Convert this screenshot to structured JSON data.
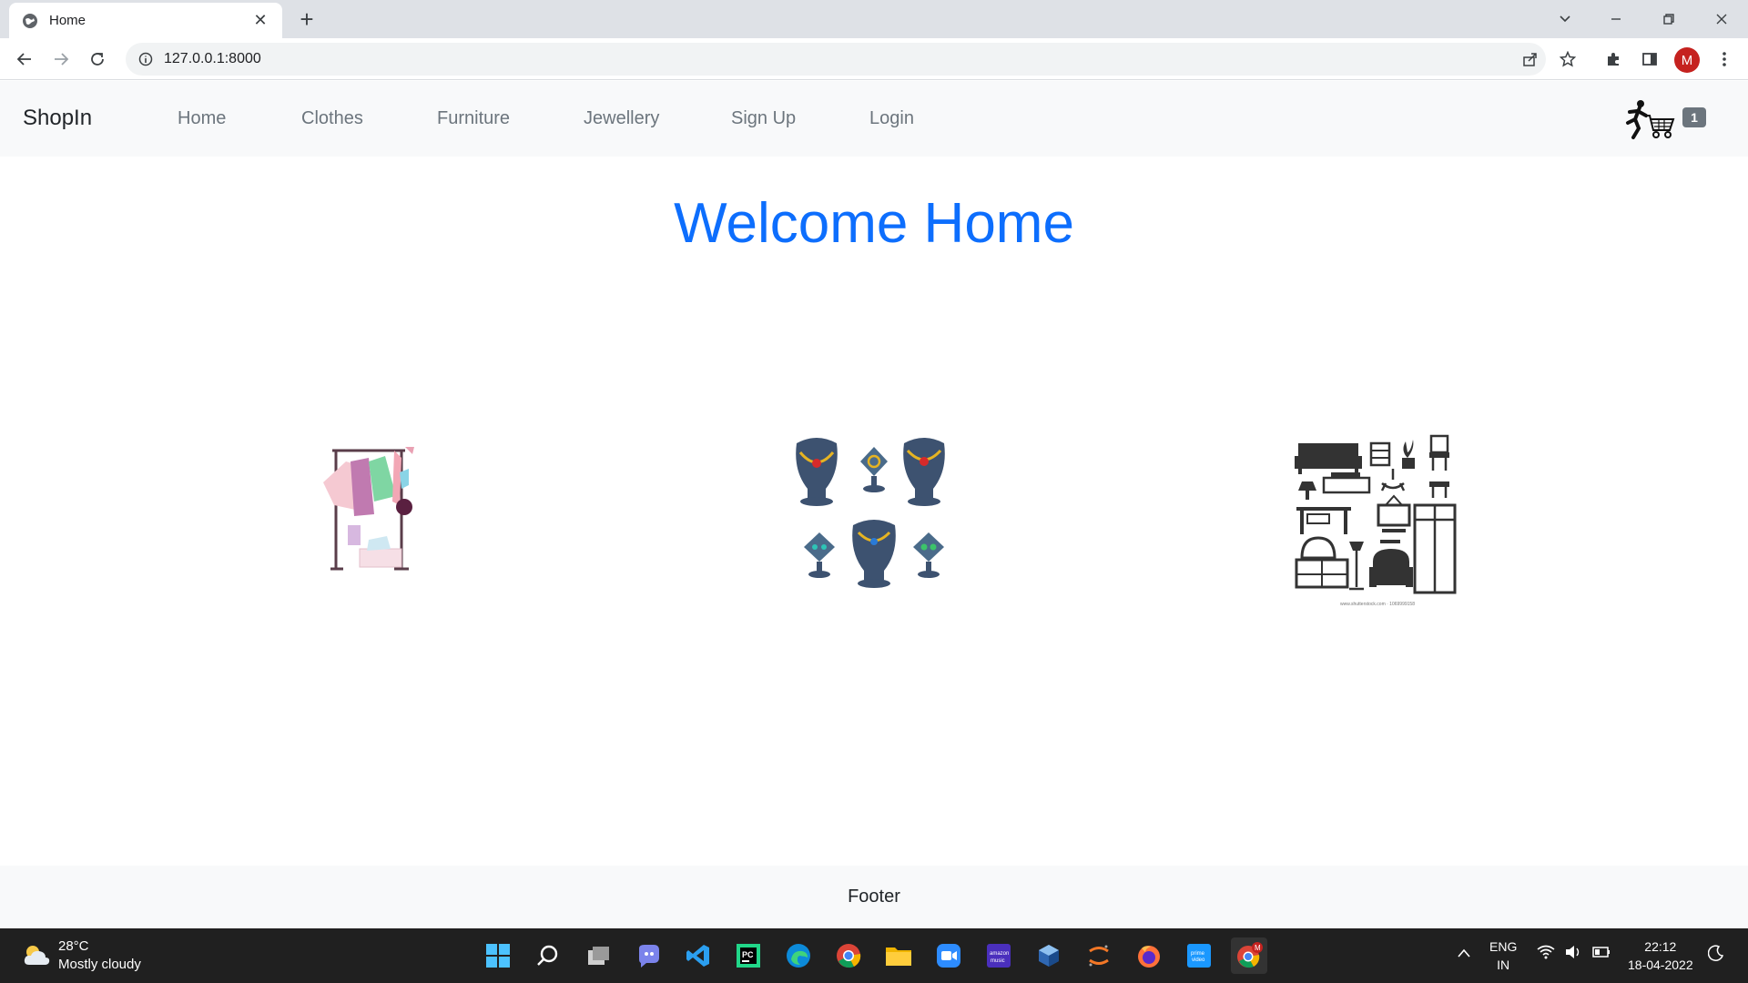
{
  "browser": {
    "tab_title": "Home",
    "url": "127.0.0.1:8000",
    "profile_initial": "M"
  },
  "site": {
    "brand": "ShopIn",
    "nav": [
      "Home",
      "Clothes",
      "Furniture",
      "Jewellery",
      "Sign Up",
      "Login"
    ],
    "cart_count": "1",
    "heading": "Welcome Home",
    "categories": [
      "clothes-image",
      "jewellery-image",
      "furniture-image"
    ],
    "footer": "Footer"
  },
  "taskbar": {
    "temperature": "28°C",
    "weather": "Mostly cloudy",
    "lang_line1": "ENG",
    "lang_line2": "IN",
    "time": "22:12",
    "date": "18-04-2022"
  },
  "colors": {
    "accent": "#0d6efd",
    "navbar_bg": "#f8f9fa",
    "taskbar_bg": "#202020"
  }
}
